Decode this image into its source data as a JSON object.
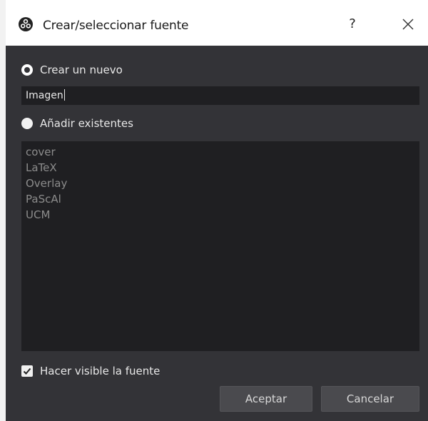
{
  "window": {
    "title": "Crear/seleccionar fuente",
    "help_label": "?",
    "app_icon": "obs-logo-icon",
    "close_icon": "close-icon"
  },
  "create_new": {
    "label": "Crear un nuevo",
    "selected": true,
    "name_value": "Imagen"
  },
  "add_existing": {
    "label": "Añadir existentes",
    "selected": false,
    "items": [
      "cover",
      "LaTeX",
      "Overlay",
      "PaScAl",
      "UCM"
    ]
  },
  "visible_checkbox": {
    "label": "Hacer visible la fuente",
    "checked": true
  },
  "buttons": {
    "ok_label": "Aceptar",
    "cancel_label": "Cancelar"
  },
  "colors": {
    "background": "#333337",
    "field_background": "#1f1f22",
    "text": "#e8e8e8",
    "disabled_text": "#8c8c8c",
    "button": "#4a4a4e"
  }
}
